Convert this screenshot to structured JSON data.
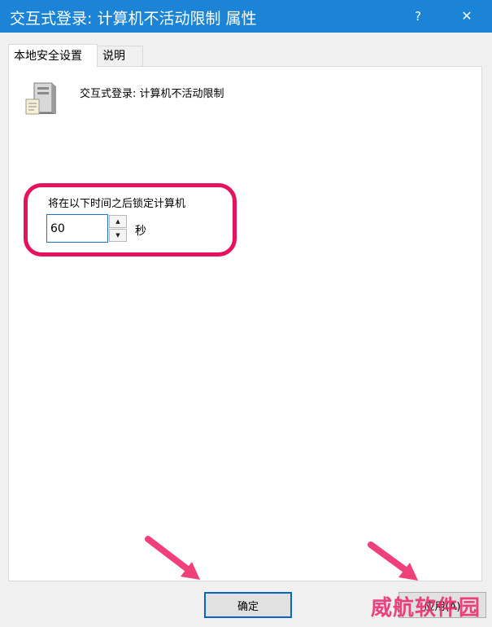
{
  "window": {
    "title": "交互式登录: 计算机不活动限制 属性",
    "help_label": "?",
    "close_label": "✕",
    "titlebar_color": "#1c84d6"
  },
  "tabs": [
    {
      "label": "本地安全设置",
      "active": true
    },
    {
      "label": "说明",
      "active": false
    }
  ],
  "policy": {
    "icon": "server-icon",
    "name": "交互式登录: 计算机不活动限制"
  },
  "lock_setting": {
    "label": "将在以下时间之后锁定计算机",
    "value": "60",
    "unit": "秒"
  },
  "annotation": {
    "highlight_color": "#e6125f",
    "arrow_color": "#f0407a"
  },
  "buttons": {
    "ok_label": "确定",
    "apply_label": "应用(A)"
  },
  "watermark": {
    "text": "威航软件园"
  }
}
